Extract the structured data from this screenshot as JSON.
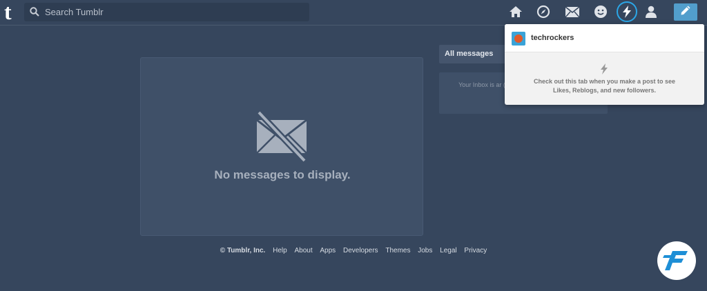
{
  "header": {
    "logo_letter": "t",
    "search_placeholder": "Search Tumblr"
  },
  "nav": {
    "icons": [
      "home-icon",
      "explore-icon",
      "inbox-icon",
      "messaging-icon",
      "activity-icon",
      "account-icon"
    ],
    "active": "activity-icon",
    "compose_icon": "pencil-icon"
  },
  "inbox": {
    "empty_message": "No messages to display."
  },
  "sidebar": {
    "tab_label": "All messages",
    "info_text": "Your Inbox is ar (Questions, Fan Ma"
  },
  "activity_dropdown": {
    "username": "techrockers",
    "hint": "Check out this tab when you make a post to see Likes, Reblogs, and new followers."
  },
  "footer": {
    "copyright": "© Tumblr, Inc.",
    "links": [
      "Help",
      "About",
      "Apps",
      "Developers",
      "Themes",
      "Jobs",
      "Legal",
      "Privacy"
    ]
  },
  "colors": {
    "background": "#36465d",
    "accent": "#529ecc",
    "active_ring": "#2ba7e8"
  }
}
